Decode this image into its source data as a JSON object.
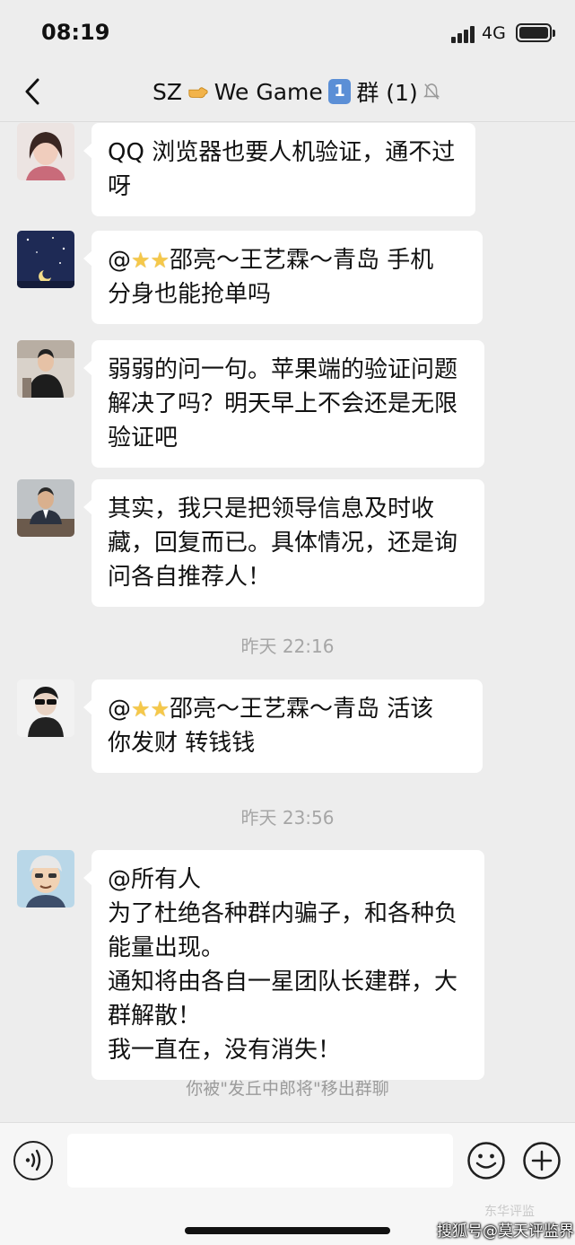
{
  "status_bar": {
    "time": "08:19",
    "network": "4G"
  },
  "nav": {
    "title_prefix": "SZ",
    "title_game": "We Game",
    "title_badge": "1",
    "title_suffix": "群 (1)"
  },
  "messages": [
    {
      "avatar": "avatar-woman",
      "lines": [
        "QQ 浏览器也要人机验证，通不过",
        "呀"
      ]
    },
    {
      "avatar": "avatar-night-sky",
      "mention_prefix": "@",
      "lines_after_stars": [
        "邵亮～王艺霖～青岛 手机"
      ],
      "lines": [
        "分身也能抢单吗"
      ]
    },
    {
      "avatar": "avatar-man-room",
      "lines": [
        "弱弱的问一句。苹果端的验证问题",
        "解决了吗？明天早上不会还是无限",
        "验证吧"
      ]
    },
    {
      "avatar": "avatar-man-desk",
      "lines": [
        "其实，我只是把领导信息及时收",
        "藏，回复而已。具体情况，还是询",
        "问各自推荐人！"
      ]
    },
    {
      "avatar": "avatar-sunglasses",
      "mention_prefix": "@",
      "lines_after_stars": [
        "邵亮～王艺霖～青岛 活该"
      ],
      "lines": [
        "你发财 转钱钱"
      ]
    },
    {
      "avatar": "avatar-cartoon",
      "lines": [
        "@所有人",
        "为了杜绝各种群内骗子，和各种负",
        "能量出现。",
        "通知将由各自一星团队长建群，大",
        "群解散！",
        "我一直在，没有消失！"
      ]
    }
  ],
  "timestamps": [
    "昨天 22:16",
    "昨天 23:56"
  ],
  "system_note": "你被\"发丘中郎将\"移出群聊",
  "watermark": {
    "main": "搜狐号@莫天评监界",
    "faint": "东华评监"
  },
  "colors": {
    "background": "#ededed",
    "bubble": "#ffffff",
    "star": "#f5c84a",
    "badge": "#5b8fd6"
  }
}
